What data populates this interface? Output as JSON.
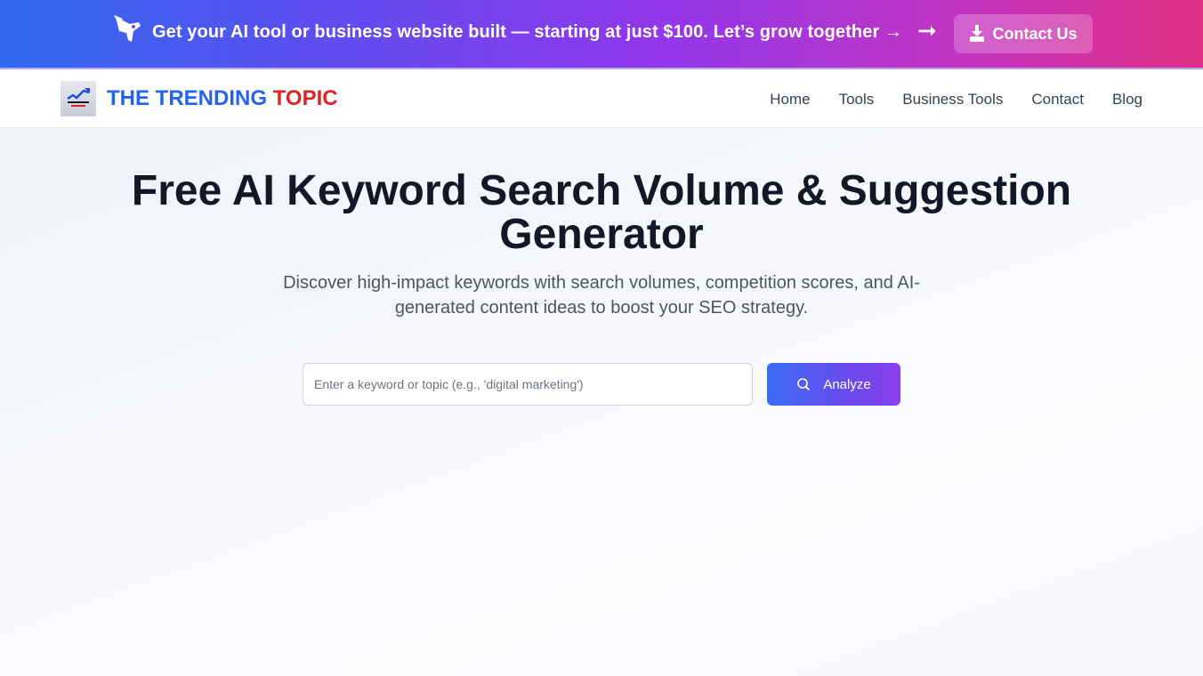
{
  "promo": {
    "text": "Get your AI tool or business website built — starting at just $100. Let’s grow together →",
    "arrow": "➞",
    "contact_label": "Contact Us",
    "icons": [
      "rocket-icon",
      "download-icon"
    ]
  },
  "header": {
    "logo_text_blue": "THE TRENDING",
    "logo_text_red": "TOPIC",
    "nav": [
      {
        "label": "Home"
      },
      {
        "label": "Tools"
      },
      {
        "label": "Business Tools"
      },
      {
        "label": "Contact"
      },
      {
        "label": "Blog"
      }
    ]
  },
  "hero": {
    "title": "Free AI Keyword Search Volume & Suggestion Generator",
    "subtitle": "Discover high-impact keywords with search volumes, competition scores, and AI-generated content ideas to boost your SEO strategy.",
    "search_placeholder": "Enter a keyword or topic (e.g., 'digital marketing')",
    "search_value": "",
    "analyze_label": "Analyze"
  },
  "colors": {
    "brand_blue": "#2563eb",
    "brand_red": "#dc2626",
    "gradient_start": "#2f6bf0",
    "gradient_end": "#df2f86"
  }
}
